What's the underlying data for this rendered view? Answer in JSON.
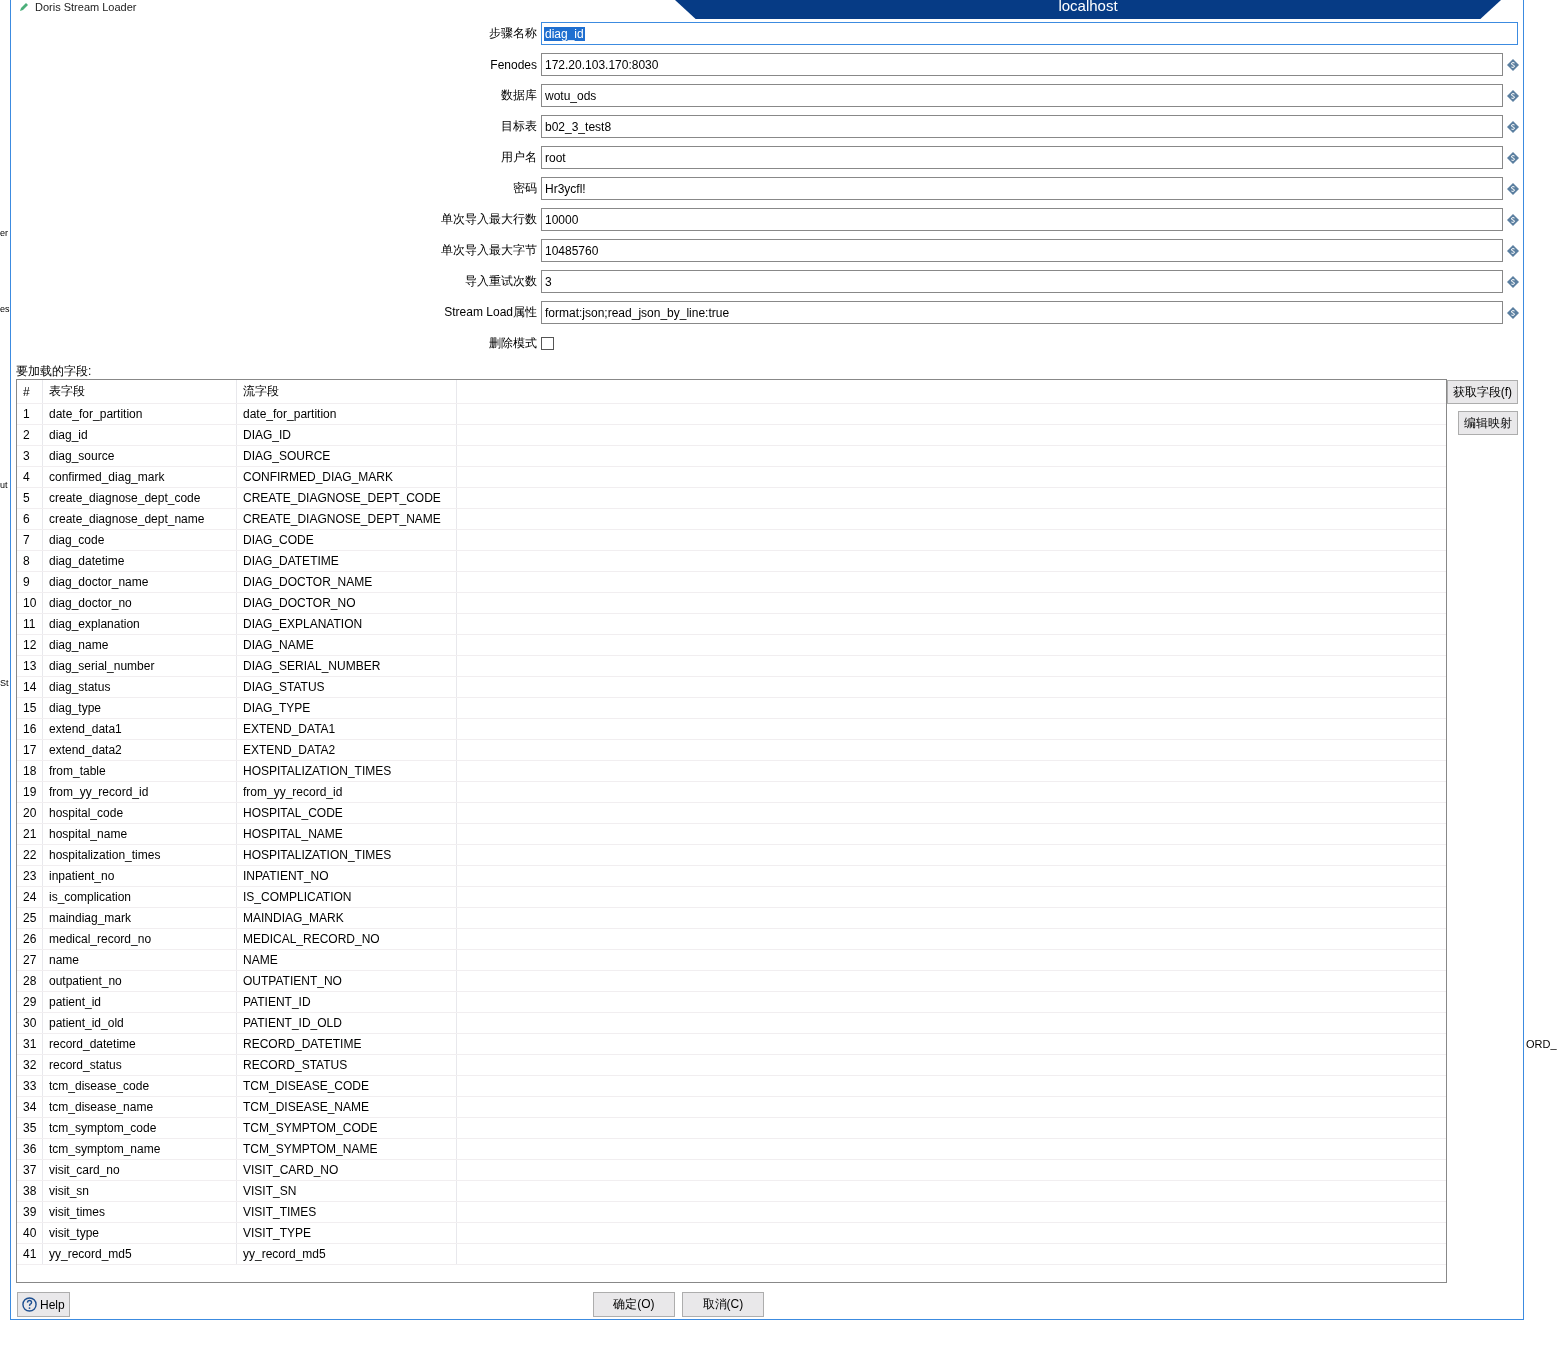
{
  "window": {
    "title": "Doris Stream Loader",
    "remote_tab": "localhost"
  },
  "background_fragments": {
    "left": [
      "er",
      "es",
      "ut",
      "St"
    ],
    "right": [
      "ORD_"
    ]
  },
  "fields": [
    {
      "label": "步骤名称",
      "value": "diag_id",
      "selected": true,
      "variable": false
    },
    {
      "label": "Fenodes",
      "value": "172.20.103.170:8030",
      "selected": false,
      "variable": true
    },
    {
      "label": "数据库",
      "value": "wotu_ods",
      "selected": false,
      "variable": true
    },
    {
      "label": "目标表",
      "value": "b02_3_test8",
      "selected": false,
      "variable": true
    },
    {
      "label": "用户名",
      "value": "root",
      "selected": false,
      "variable": true
    },
    {
      "label": "密码",
      "value": "Hr3ycfl!",
      "selected": false,
      "variable": true
    },
    {
      "label": "单次导入最大行数",
      "value": "10000",
      "selected": false,
      "variable": true
    },
    {
      "label": "单次导入最大字节",
      "value": "10485760",
      "selected": false,
      "variable": true
    },
    {
      "label": "导入重试次数",
      "value": "3",
      "selected": false,
      "variable": true
    },
    {
      "label": "Stream Load属性",
      "value": "format:json;read_json_by_line:true",
      "selected": false,
      "variable": true
    }
  ],
  "delete_mode": {
    "label": "删除模式",
    "checked": false
  },
  "fields_section": {
    "title": "要加载的字段:",
    "columns": [
      "#",
      "表字段",
      "流字段"
    ],
    "rows": [
      [
        "1",
        "date_for_partition",
        "date_for_partition"
      ],
      [
        "2",
        "diag_id",
        "DIAG_ID"
      ],
      [
        "3",
        "diag_source",
        "DIAG_SOURCE"
      ],
      [
        "4",
        "confirmed_diag_mark",
        "CONFIRMED_DIAG_MARK"
      ],
      [
        "5",
        "create_diagnose_dept_code",
        "CREATE_DIAGNOSE_DEPT_CODE"
      ],
      [
        "6",
        "create_diagnose_dept_name",
        "CREATE_DIAGNOSE_DEPT_NAME"
      ],
      [
        "7",
        "diag_code",
        "DIAG_CODE"
      ],
      [
        "8",
        "diag_datetime",
        "DIAG_DATETIME"
      ],
      [
        "9",
        "diag_doctor_name",
        "DIAG_DOCTOR_NAME"
      ],
      [
        "10",
        "diag_doctor_no",
        "DIAG_DOCTOR_NO"
      ],
      [
        "11",
        "diag_explanation",
        "DIAG_EXPLANATION"
      ],
      [
        "12",
        "diag_name",
        "DIAG_NAME"
      ],
      [
        "13",
        "diag_serial_number",
        "DIAG_SERIAL_NUMBER"
      ],
      [
        "14",
        "diag_status",
        "DIAG_STATUS"
      ],
      [
        "15",
        "diag_type",
        "DIAG_TYPE"
      ],
      [
        "16",
        "extend_data1",
        "EXTEND_DATA1"
      ],
      [
        "17",
        "extend_data2",
        "EXTEND_DATA2"
      ],
      [
        "18",
        "from_table",
        "HOSPITALIZATION_TIMES"
      ],
      [
        "19",
        "from_yy_record_id",
        "from_yy_record_id"
      ],
      [
        "20",
        "hospital_code",
        "HOSPITAL_CODE"
      ],
      [
        "21",
        "hospital_name",
        "HOSPITAL_NAME"
      ],
      [
        "22",
        "hospitalization_times",
        "HOSPITALIZATION_TIMES"
      ],
      [
        "23",
        "inpatient_no",
        "INPATIENT_NO"
      ],
      [
        "24",
        "is_complication",
        "IS_COMPLICATION"
      ],
      [
        "25",
        "maindiag_mark",
        "MAINDIAG_MARK"
      ],
      [
        "26",
        "medical_record_no",
        "MEDICAL_RECORD_NO"
      ],
      [
        "27",
        "name",
        "NAME"
      ],
      [
        "28",
        "outpatient_no",
        "OUTPATIENT_NO"
      ],
      [
        "29",
        "patient_id",
        "PATIENT_ID"
      ],
      [
        "30",
        "patient_id_old",
        "PATIENT_ID_OLD"
      ],
      [
        "31",
        "record_datetime",
        "RECORD_DATETIME"
      ],
      [
        "32",
        "record_status",
        "RECORD_STATUS"
      ],
      [
        "33",
        "tcm_disease_code",
        "TCM_DISEASE_CODE"
      ],
      [
        "34",
        "tcm_disease_name",
        "TCM_DISEASE_NAME"
      ],
      [
        "35",
        "tcm_symptom_code",
        "TCM_SYMPTOM_CODE"
      ],
      [
        "36",
        "tcm_symptom_name",
        "TCM_SYMPTOM_NAME"
      ],
      [
        "37",
        "visit_card_no",
        "VISIT_CARD_NO"
      ],
      [
        "38",
        "visit_sn",
        "VISIT_SN"
      ],
      [
        "39",
        "visit_times",
        "VISIT_TIMES"
      ],
      [
        "40",
        "visit_type",
        "VISIT_TYPE"
      ],
      [
        "41",
        "yy_record_md5",
        "yy_record_md5"
      ]
    ],
    "side_buttons": [
      "获取字段(f)",
      "编辑映射"
    ]
  },
  "footer": {
    "help": "Help",
    "buttons": [
      "确定(O)",
      "取消(C)"
    ]
  }
}
